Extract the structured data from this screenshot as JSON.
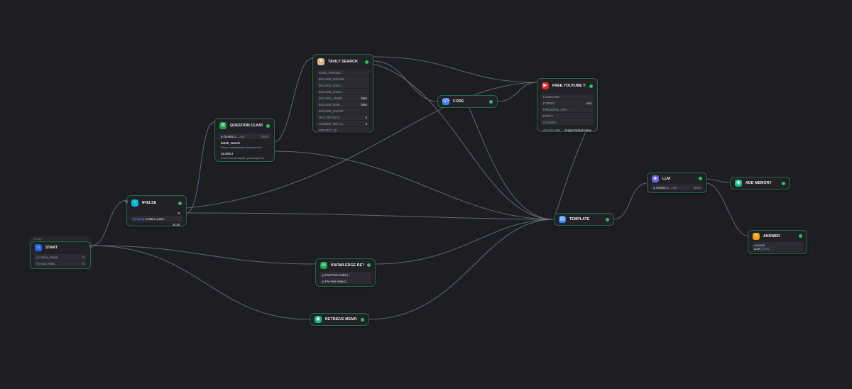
{
  "colors": {
    "canvas": "#1d1d22",
    "node_bg": "#222226",
    "node_border": "#1f6b48",
    "status": "#22c55e",
    "edge": "#6e7383"
  },
  "start_group_label": "START",
  "start": {
    "title": "START",
    "icon": "home-icon",
    "vars": [
      {
        "prefix": "{x}",
        "name": "Nama_Siswa"
      },
      {
        "prefix": "{x}",
        "name": "Asal_Kelas"
      }
    ]
  },
  "ifelse": {
    "title": "IF/ELSE",
    "icon": "branch-icon",
    "if_label": "IF",
    "cond_var": "{x} query",
    "cond_op": "contains",
    "cond_value": "youtu",
    "else_label": "ELSE"
  },
  "classifier": {
    "title": "QUESTION CLASSIFIER",
    "icon": "classifier-icon",
    "model": "Gemini 3...",
    "model_badge": "CHAT",
    "class1_name": "butuh_search",
    "class1_desc": "Pesan membutuhkan informasi berh",
    "class2_name": "CLASS 2",
    "class2_desc": "Pesan berupa sapaan, percakapan us"
  },
  "tavily": {
    "title": "TAVILY SEARCH",
    "icon": "tavily-icon",
    "params": [
      {
        "name": "AUTO_PARAME...",
        "value": ""
      },
      {
        "name": "INCLUDE_IMAGES",
        "value": ""
      },
      {
        "name": "INCLUDE_IMAG...",
        "value": ""
      },
      {
        "name": "INCLUDE_FAVIC...",
        "value": ""
      },
      {
        "name": "INCLUDE_ANSW...",
        "value": "false"
      },
      {
        "name": "INCLUDE_RAW_...",
        "value": "false"
      },
      {
        "name": "INCLUDE_USAGE",
        "value": ""
      },
      {
        "name": "MAX_RESULTS",
        "value": "5"
      },
      {
        "name": "CHUNKS_PER_S...",
        "value": "3"
      },
      {
        "name": "PROJECT_ID",
        "value": ""
      }
    ]
  },
  "code": {
    "title": "CODE",
    "icon": "code-icon"
  },
  "youtube": {
    "title": "FREE YOUTUBE TRANSCRI...",
    "icon": "youtube-icon",
    "params": [
      {
        "name": "LANGUAGE",
        "value": ""
      },
      {
        "name": "FORMAT",
        "value": "text"
      },
      {
        "name": "PRESERVE_FOR...",
        "value": ""
      },
      {
        "name": "PROXY",
        "value": ""
      },
      {
        "name": "COOKIES",
        "value": ""
      }
    ],
    "on_failure_label": "ON FAILURE",
    "on_failure_value": "Output Default Value"
  },
  "template": {
    "title": "TEMPLATE",
    "icon": "template-icon"
  },
  "llm": {
    "title": "LLM",
    "icon": "llm-icon",
    "model": "Gemini 3...",
    "model_badge": "CHAT"
  },
  "add_memory": {
    "title": "ADD MEMORY",
    "icon": "memory-icon"
  },
  "answer": {
    "title": "ANSWER",
    "icon": "answer-icon",
    "label": "ANSWER",
    "ref": "LLM",
    "ref_badge": "{x} text"
  },
  "knowledge": {
    "title": "KNOWLEDGE RETRIEVAL",
    "icon": "knowledge-icon",
    "items": [
      {
        "name": "Post-Test modul (..."
      },
      {
        "name": "Pre-Test modul (..."
      }
    ]
  },
  "retrieve_memory": {
    "title": "RETRIEVE MEMORY",
    "icon": "memory-icon"
  }
}
